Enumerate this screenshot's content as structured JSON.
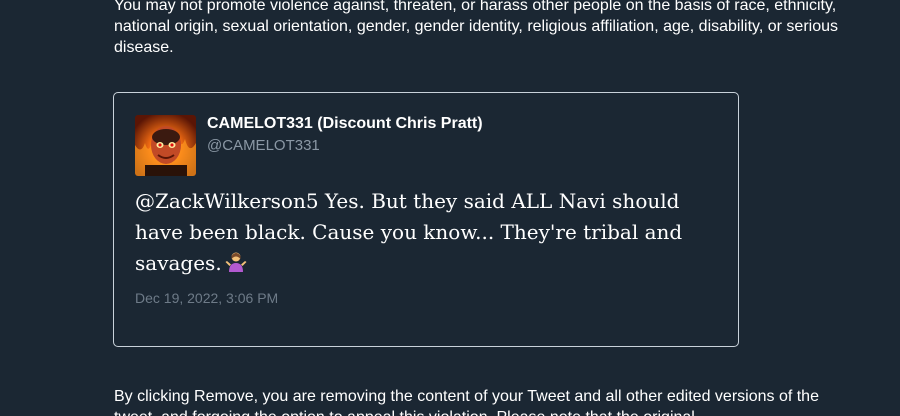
{
  "policy": {
    "text": "You may not promote violence against, threaten, or harass other people on the basis of race, ethnicity, national origin, sexual orientation, gender, gender identity, religious affiliation, age, disability, or serious disease."
  },
  "tweet": {
    "display_name": "CAMELOT331 (Discount Chris Pratt)",
    "handle": "@CAMELOT331",
    "text": "@ZackWilkerson5 Yes. But they said ALL Navi should have been black. Cause you know... They're tribal and savages.",
    "emoji": "person-shrugging",
    "timestamp": "Dec 19, 2022, 3:06 PM",
    "avatar": "profile-photo"
  },
  "removal": {
    "text": "By clicking Remove, you are removing the content of your Tweet and all other edited versions of the tweet, and forgoing the option to appeal this violation. Please note that the original"
  }
}
